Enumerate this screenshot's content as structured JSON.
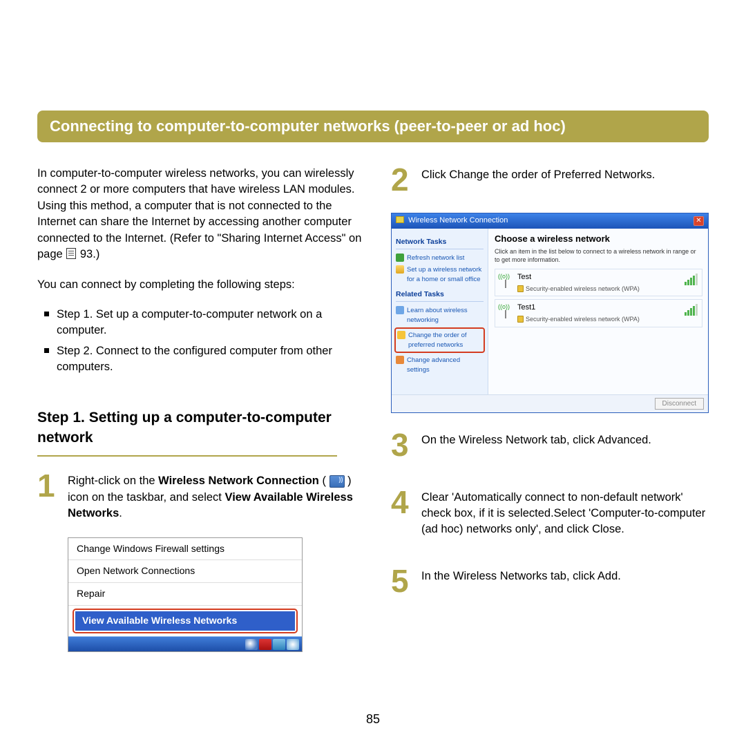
{
  "title": "Connecting to computer-to-computer networks (peer-to-peer or ad hoc)",
  "intro": {
    "para1_a": "In computer-to-computer wireless networks, you can wirelessly connect 2 or more computers that have wireless LAN modules. Using this method, a computer that is not connected to the Internet can share the Internet by accessing another computer connected to the Internet. (Refer to \"Sharing Internet Access\" on page ",
    "para1_b": " 93.)",
    "para2": "You can connect by completing the following steps:",
    "bullets": [
      "Step 1. Set up a computer-to-computer network on a computer.",
      "Step 2. Connect to the configured computer from other computers."
    ]
  },
  "step_heading": "Step 1. Setting up a computer-to-computer network",
  "steps": {
    "s1_a": "Right-click on the ",
    "s1_bold1": "Wireless Network Connection",
    "s1_b": " ( ",
    "s1_c": " ) icon on the taskbar, and select ",
    "s1_bold2": "View Available Wireless Networks",
    "s1_d": ".",
    "s2": "Click Change the order of Preferred Networks.",
    "s3": "On the Wireless Network tab, click Advanced.",
    "s4": "Clear 'Automatically connect to non-default network' check box, if it is selected.Select 'Computer-to-computer (ad hoc) networks only', and click Close.",
    "s5": "In the Wireless Networks tab, click Add."
  },
  "context_menu": {
    "items": [
      "Change Windows Firewall settings",
      "Open Network Connections",
      "Repair"
    ],
    "highlighted": "View Available Wireless Networks"
  },
  "wifi_dialog": {
    "title": "Wireless Network Connection",
    "side": {
      "hdr1": "Network Tasks",
      "refresh": "Refresh network list",
      "setup": "Set up a wireless network for a home or small office",
      "hdr2": "Related Tasks",
      "learn": "Learn about wireless networking",
      "order": "Change the order of preferred networks",
      "adv": "Change advanced settings"
    },
    "main_title": "Choose a wireless network",
    "main_sub": "Click an item in the list below to connect to a wireless network in range or to get more information.",
    "networks": [
      {
        "name": "Test",
        "sec": "Security-enabled wireless network (WPA)"
      },
      {
        "name": "Test1",
        "sec": "Security-enabled wireless network (WPA)"
      }
    ],
    "disconnect": "Disconnect"
  },
  "page_number": "85"
}
